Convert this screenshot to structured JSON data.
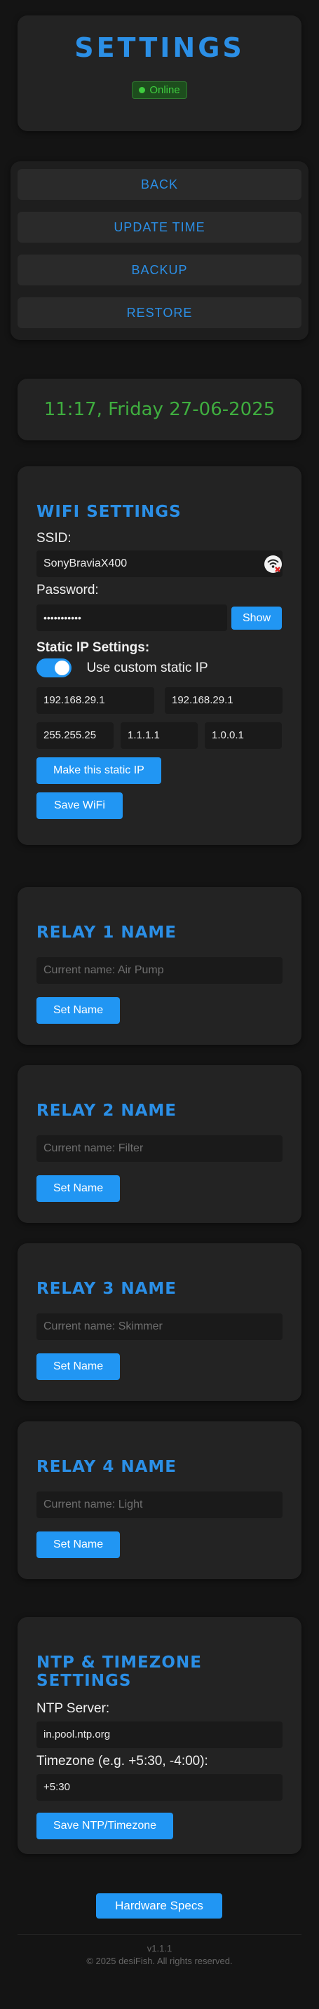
{
  "header": {
    "title": "SETTINGS",
    "status": "Online"
  },
  "nav": {
    "back": "BACK",
    "update_time": "UPDATE TIME",
    "backup": "BACKUP",
    "restore": "RESTORE"
  },
  "clock": {
    "text": "11:17, Friday 27-06-2025"
  },
  "wifi": {
    "title": "WIFI SETTINGS",
    "ssid_label": "SSID:",
    "ssid_value": "SonyBraviaX400",
    "password_label": "Password:",
    "password_value": "•••••••••••",
    "show_label": "Show",
    "static_label": "Static IP Settings:",
    "custom_label": "Use custom static IP",
    "ip": "192.168.29.1",
    "gateway": "192.168.29.1",
    "subnet": "255.255.25",
    "dns1": "1.1.1.1",
    "dns2": "1.0.0.1",
    "make_static_label": "Make this static IP",
    "save_label": "Save WiFi"
  },
  "relays": [
    {
      "title": "RELAY 1 NAME",
      "placeholder": "Current name: Air Pump",
      "button": "Set Name"
    },
    {
      "title": "RELAY 2 NAME",
      "placeholder": "Current name: Filter",
      "button": "Set Name"
    },
    {
      "title": "RELAY 3 NAME",
      "placeholder": "Current name: Skimmer",
      "button": "Set Name"
    },
    {
      "title": "RELAY 4 NAME",
      "placeholder": "Current name: Light",
      "button": "Set Name"
    }
  ],
  "ntp": {
    "title": "NTP & TIMEZONE SETTINGS",
    "server_label": "NTP Server:",
    "server_value": "in.pool.ntp.org",
    "tz_label": "Timezone (e.g. +5:30, -4:00):",
    "tz_value": "+5:30",
    "save_label": "Save NTP/Timezone"
  },
  "footer": {
    "hardware_button": "Hardware Specs",
    "version": "v1.1.1",
    "copyright": "© 2025 desiFish. All rights reserved."
  },
  "colors": {
    "accent": "#2b8fe6",
    "button": "#2196f3",
    "online": "#3fcc3f",
    "clock": "#3fae3f"
  },
  "icons": {
    "wifi_status": "wifi-off-icon"
  }
}
